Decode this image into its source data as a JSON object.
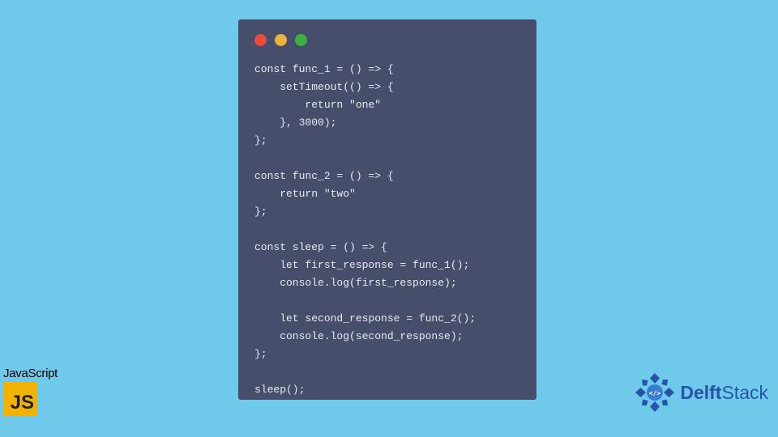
{
  "code_window": {
    "lines": [
      "const func_1 = () => {",
      "    setTimeout(() => {",
      "        return \"one\"",
      "    }, 3000);",
      "};",
      "",
      "const func_2 = () => {",
      "    return \"two\"",
      "};",
      "",
      "const sleep = () => {",
      "    let first_response = func_1();",
      "    console.log(first_response);",
      "",
      "    let second_response = func_2();",
      "    console.log(second_response);",
      "};",
      "",
      "sleep();"
    ]
  },
  "js_badge": {
    "label": "JavaScript",
    "icon_text": "JS"
  },
  "delft": {
    "part1": "Delft",
    "part2": "Stack"
  },
  "colors": {
    "bg": "#6ec9ea",
    "window": "#474e6c",
    "red": "#e94b3c",
    "yellow": "#e8b33a",
    "green": "#3cb043",
    "js_gold": "#f0b400",
    "delft_blue": "#2854a8"
  }
}
